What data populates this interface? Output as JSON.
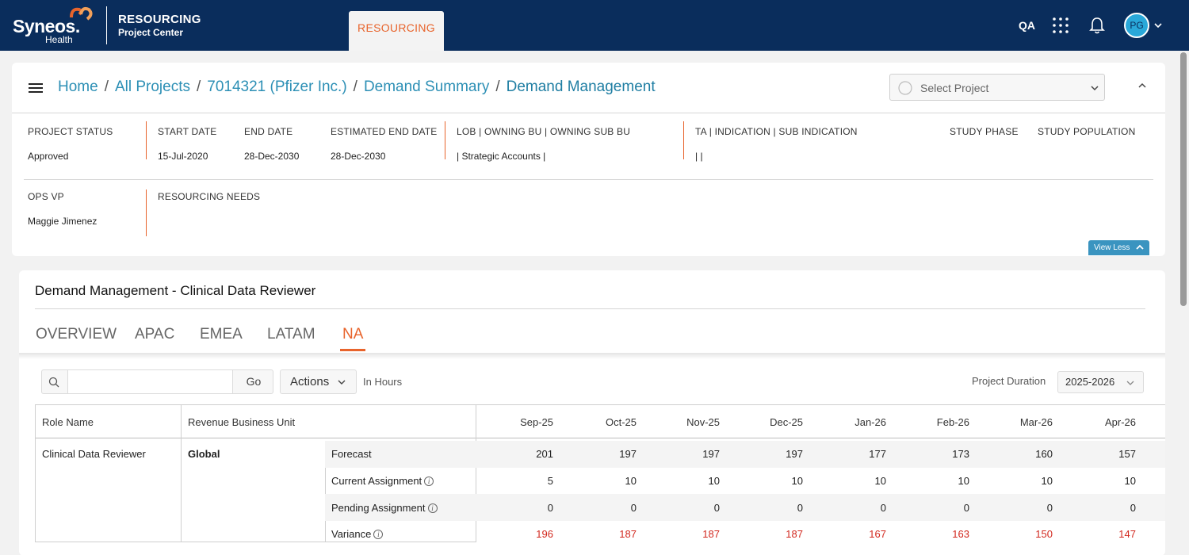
{
  "brand": {
    "name": "Syneos.",
    "sub": "Health"
  },
  "app": {
    "title": "RESOURCING",
    "subtitle": "Project Center"
  },
  "top_nav": {
    "active_tab": "RESOURCING",
    "env": "QA",
    "avatar_initials": "PG",
    "colors": {
      "bar": "#0a2d5c",
      "accent": "#e8642c"
    }
  },
  "breadcrumb": {
    "items": [
      "Home",
      "All Projects",
      "7014321 (Pfizer Inc.)",
      "Demand Summary"
    ],
    "current": "Demand Management"
  },
  "select_project": {
    "placeholder": "Select Project"
  },
  "project": {
    "status_label": "PROJECT STATUS",
    "status": "Approved",
    "start_label": "START DATE",
    "start": "15-Jul-2020",
    "end_label": "END DATE",
    "end": "28-Dec-2030",
    "est_end_label": "ESTIMATED END DATE",
    "est_end": "28-Dec-2030",
    "lob_label": "LOB | OWNING BU | OWNING SUB BU",
    "lob": "| Strategic Accounts |",
    "ta_label": "TA | INDICATION | SUB INDICATION",
    "ta": "| |",
    "phase_label": "STUDY PHASE",
    "population_label": "STUDY POPULATION",
    "opsvp_label": "OPS VP",
    "opsvp": "Maggie Jimenez",
    "needs_label": "RESOURCING NEEDS",
    "view_less": "View Less"
  },
  "demand": {
    "title": "Demand Management - Clinical Data Reviewer",
    "tabs": [
      "OVERVIEW",
      "APAC",
      "EMEA",
      "LATAM",
      "NA"
    ],
    "active_tab": "NA",
    "go_label": "Go",
    "actions_label": "Actions",
    "in_hours": "In Hours",
    "duration_label": "Project Duration",
    "duration_value": "2025-2026",
    "table": {
      "headers": {
        "role": "Role Name",
        "rbu": "Revenue Business Unit"
      },
      "months": [
        "Sep-25",
        "Oct-25",
        "Nov-25",
        "Dec-25",
        "Jan-26",
        "Feb-26",
        "Mar-26",
        "Apr-26"
      ],
      "role_name": "Clinical Data Reviewer",
      "rbu": "Global",
      "rows": [
        {
          "label": "Forecast",
          "values": [
            "201",
            "197",
            "197",
            "197",
            "177",
            "173",
            "160",
            "157"
          ]
        },
        {
          "label": "Current Assignment",
          "values": [
            "5",
            "10",
            "10",
            "10",
            "10",
            "10",
            "10",
            "10"
          ]
        },
        {
          "label": "Pending Assignment",
          "values": [
            "0",
            "0",
            "0",
            "0",
            "0",
            "0",
            "0",
            "0"
          ]
        },
        {
          "label": "Variance",
          "values": [
            "196",
            "187",
            "187",
            "187",
            "167",
            "163",
            "150",
            "147"
          ]
        }
      ]
    }
  }
}
